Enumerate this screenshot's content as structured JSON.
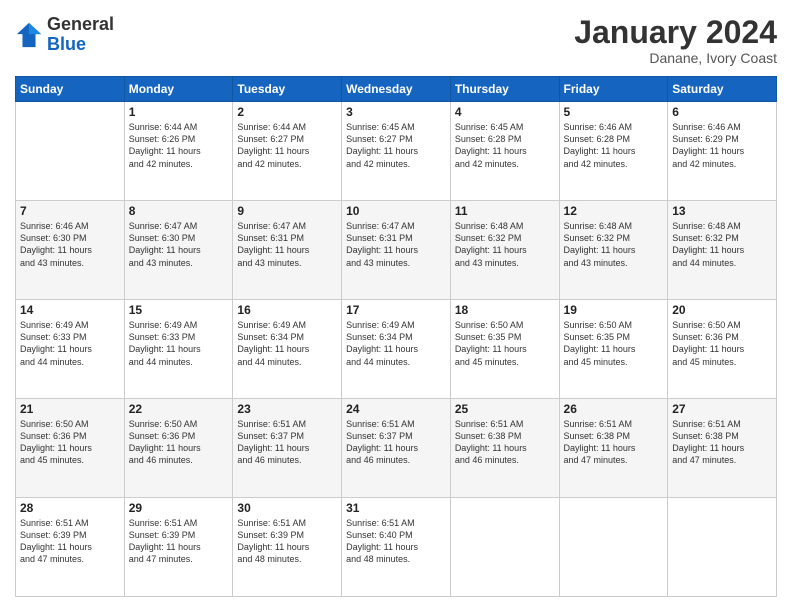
{
  "logo": {
    "general": "General",
    "blue": "Blue"
  },
  "header": {
    "title": "January 2024",
    "location": "Danane, Ivory Coast"
  },
  "weekdays": [
    "Sunday",
    "Monday",
    "Tuesday",
    "Wednesday",
    "Thursday",
    "Friday",
    "Saturday"
  ],
  "weeks": [
    [
      {
        "day": "",
        "content": ""
      },
      {
        "day": "1",
        "content": "Sunrise: 6:44 AM\nSunset: 6:26 PM\nDaylight: 11 hours\nand 42 minutes."
      },
      {
        "day": "2",
        "content": "Sunrise: 6:44 AM\nSunset: 6:27 PM\nDaylight: 11 hours\nand 42 minutes."
      },
      {
        "day": "3",
        "content": "Sunrise: 6:45 AM\nSunset: 6:27 PM\nDaylight: 11 hours\nand 42 minutes."
      },
      {
        "day": "4",
        "content": "Sunrise: 6:45 AM\nSunset: 6:28 PM\nDaylight: 11 hours\nand 42 minutes."
      },
      {
        "day": "5",
        "content": "Sunrise: 6:46 AM\nSunset: 6:28 PM\nDaylight: 11 hours\nand 42 minutes."
      },
      {
        "day": "6",
        "content": "Sunrise: 6:46 AM\nSunset: 6:29 PM\nDaylight: 11 hours\nand 42 minutes."
      }
    ],
    [
      {
        "day": "7",
        "content": "Sunrise: 6:46 AM\nSunset: 6:30 PM\nDaylight: 11 hours\nand 43 minutes."
      },
      {
        "day": "8",
        "content": "Sunrise: 6:47 AM\nSunset: 6:30 PM\nDaylight: 11 hours\nand 43 minutes."
      },
      {
        "day": "9",
        "content": "Sunrise: 6:47 AM\nSunset: 6:31 PM\nDaylight: 11 hours\nand 43 minutes."
      },
      {
        "day": "10",
        "content": "Sunrise: 6:47 AM\nSunset: 6:31 PM\nDaylight: 11 hours\nand 43 minutes."
      },
      {
        "day": "11",
        "content": "Sunrise: 6:48 AM\nSunset: 6:32 PM\nDaylight: 11 hours\nand 43 minutes."
      },
      {
        "day": "12",
        "content": "Sunrise: 6:48 AM\nSunset: 6:32 PM\nDaylight: 11 hours\nand 43 minutes."
      },
      {
        "day": "13",
        "content": "Sunrise: 6:48 AM\nSunset: 6:32 PM\nDaylight: 11 hours\nand 44 minutes."
      }
    ],
    [
      {
        "day": "14",
        "content": "Sunrise: 6:49 AM\nSunset: 6:33 PM\nDaylight: 11 hours\nand 44 minutes."
      },
      {
        "day": "15",
        "content": "Sunrise: 6:49 AM\nSunset: 6:33 PM\nDaylight: 11 hours\nand 44 minutes."
      },
      {
        "day": "16",
        "content": "Sunrise: 6:49 AM\nSunset: 6:34 PM\nDaylight: 11 hours\nand 44 minutes."
      },
      {
        "day": "17",
        "content": "Sunrise: 6:49 AM\nSunset: 6:34 PM\nDaylight: 11 hours\nand 44 minutes."
      },
      {
        "day": "18",
        "content": "Sunrise: 6:50 AM\nSunset: 6:35 PM\nDaylight: 11 hours\nand 45 minutes."
      },
      {
        "day": "19",
        "content": "Sunrise: 6:50 AM\nSunset: 6:35 PM\nDaylight: 11 hours\nand 45 minutes."
      },
      {
        "day": "20",
        "content": "Sunrise: 6:50 AM\nSunset: 6:36 PM\nDaylight: 11 hours\nand 45 minutes."
      }
    ],
    [
      {
        "day": "21",
        "content": "Sunrise: 6:50 AM\nSunset: 6:36 PM\nDaylight: 11 hours\nand 45 minutes."
      },
      {
        "day": "22",
        "content": "Sunrise: 6:50 AM\nSunset: 6:36 PM\nDaylight: 11 hours\nand 46 minutes."
      },
      {
        "day": "23",
        "content": "Sunrise: 6:51 AM\nSunset: 6:37 PM\nDaylight: 11 hours\nand 46 minutes."
      },
      {
        "day": "24",
        "content": "Sunrise: 6:51 AM\nSunset: 6:37 PM\nDaylight: 11 hours\nand 46 minutes."
      },
      {
        "day": "25",
        "content": "Sunrise: 6:51 AM\nSunset: 6:38 PM\nDaylight: 11 hours\nand 46 minutes."
      },
      {
        "day": "26",
        "content": "Sunrise: 6:51 AM\nSunset: 6:38 PM\nDaylight: 11 hours\nand 47 minutes."
      },
      {
        "day": "27",
        "content": "Sunrise: 6:51 AM\nSunset: 6:38 PM\nDaylight: 11 hours\nand 47 minutes."
      }
    ],
    [
      {
        "day": "28",
        "content": "Sunrise: 6:51 AM\nSunset: 6:39 PM\nDaylight: 11 hours\nand 47 minutes."
      },
      {
        "day": "29",
        "content": "Sunrise: 6:51 AM\nSunset: 6:39 PM\nDaylight: 11 hours\nand 47 minutes."
      },
      {
        "day": "30",
        "content": "Sunrise: 6:51 AM\nSunset: 6:39 PM\nDaylight: 11 hours\nand 48 minutes."
      },
      {
        "day": "31",
        "content": "Sunrise: 6:51 AM\nSunset: 6:40 PM\nDaylight: 11 hours\nand 48 minutes."
      },
      {
        "day": "",
        "content": ""
      },
      {
        "day": "",
        "content": ""
      },
      {
        "day": "",
        "content": ""
      }
    ]
  ]
}
